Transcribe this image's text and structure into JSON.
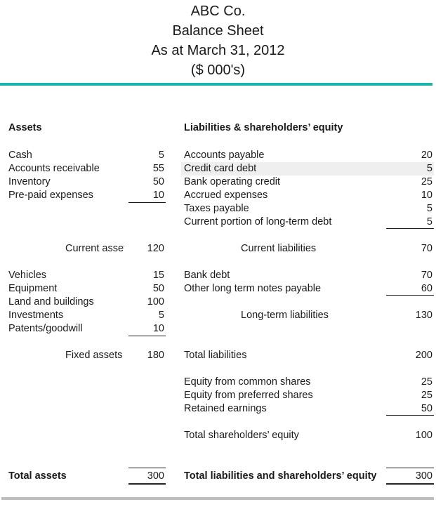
{
  "header": {
    "company": "ABC Co.",
    "title": "Balance Sheet",
    "date": "As at March 31, 2012",
    "units": "($ 000's)"
  },
  "colors": {
    "accent_rule": "#1ab5a8",
    "footer_rule": "#bdbdbd",
    "highlight_row": "#efefef"
  },
  "assets": {
    "heading": "Assets",
    "current": [
      {
        "label": "Cash",
        "value": "5"
      },
      {
        "label": "Accounts receivable",
        "value": "55"
      },
      {
        "label": "Inventory",
        "value": "50"
      },
      {
        "label": "Pre-paid expenses",
        "value": "10"
      }
    ],
    "current_total": {
      "label": "Current assets",
      "value": "120"
    },
    "fixed": [
      {
        "label": "Vehicles",
        "value": "15"
      },
      {
        "label": "Equipment",
        "value": "50"
      },
      {
        "label": "Land and buildings",
        "value": "100"
      },
      {
        "label": "Investments",
        "value": "5"
      },
      {
        "label": "Patents/goodwill",
        "value": "10"
      }
    ],
    "fixed_total": {
      "label": "Fixed assets",
      "value": "180"
    },
    "total": {
      "label": "Total assets",
      "value": "300"
    }
  },
  "liabilities": {
    "heading": "Liabilities & shareholders’ equity",
    "current": [
      {
        "label": "Accounts payable",
        "value": "20"
      },
      {
        "label": "Credit card debt",
        "value": "5"
      },
      {
        "label": "Bank operating credit",
        "value": "25"
      },
      {
        "label": "Accrued expenses",
        "value": "10"
      },
      {
        "label": "Taxes payable",
        "value": "5"
      },
      {
        "label": "Current portion of long-term debt",
        "value": "5"
      }
    ],
    "current_total": {
      "label": "Current liabilities",
      "value": "70"
    },
    "long_term": [
      {
        "label": "Bank debt",
        "value": "70"
      },
      {
        "label": "Other long term notes payable",
        "value": "60"
      }
    ],
    "long_term_total": {
      "label": "Long-term liabilities",
      "value": "130"
    },
    "total_liabilities": {
      "label": "Total liabilities",
      "value": "200"
    },
    "equity": [
      {
        "label": "Equity from common shares",
        "value": "25"
      },
      {
        "label": "Equity from preferred shares",
        "value": "25"
      },
      {
        "label": "Retained earnings",
        "value": "50"
      }
    ],
    "equity_total": {
      "label": "Total shareholders’ equity",
      "value": "100"
    },
    "grand_total": {
      "label": "Total liabilities and shareholders’ equity",
      "value": "300"
    }
  }
}
